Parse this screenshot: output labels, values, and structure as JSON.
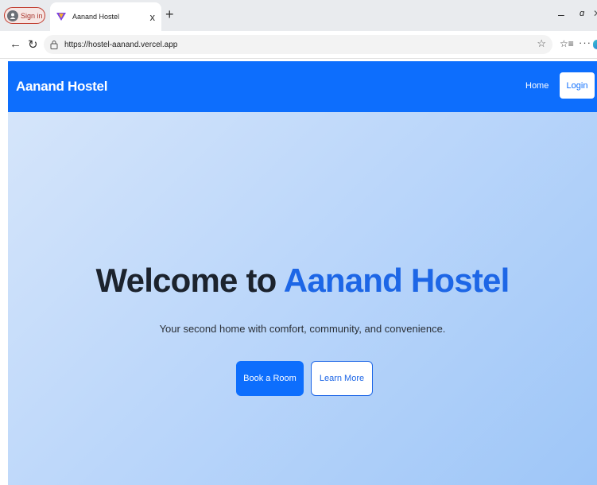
{
  "browser": {
    "signin_label": "Sign in",
    "tab_title": "Aanand Hostel",
    "tab_close": "x",
    "new_tab": "+",
    "url": "https://hostel-aanand.vercel.app",
    "minimize": "–",
    "maximize": "ɑ",
    "more": "···"
  },
  "site": {
    "brand": "Aanand Hostel",
    "nav_home": "Home",
    "nav_login": "Login"
  },
  "hero": {
    "title_prefix": "Welcome to ",
    "title_accent": "Aanand Hostel",
    "subtitle": "Your second home with comfort, community, and convenience.",
    "primary_button": "Book a Room",
    "secondary_button": "Learn More"
  },
  "colors": {
    "brand_blue": "#0d6efd",
    "accent_blue": "#1d66e6",
    "hero_gradient_start": "#d5e5fa",
    "hero_gradient_end": "#9ec6f8"
  }
}
